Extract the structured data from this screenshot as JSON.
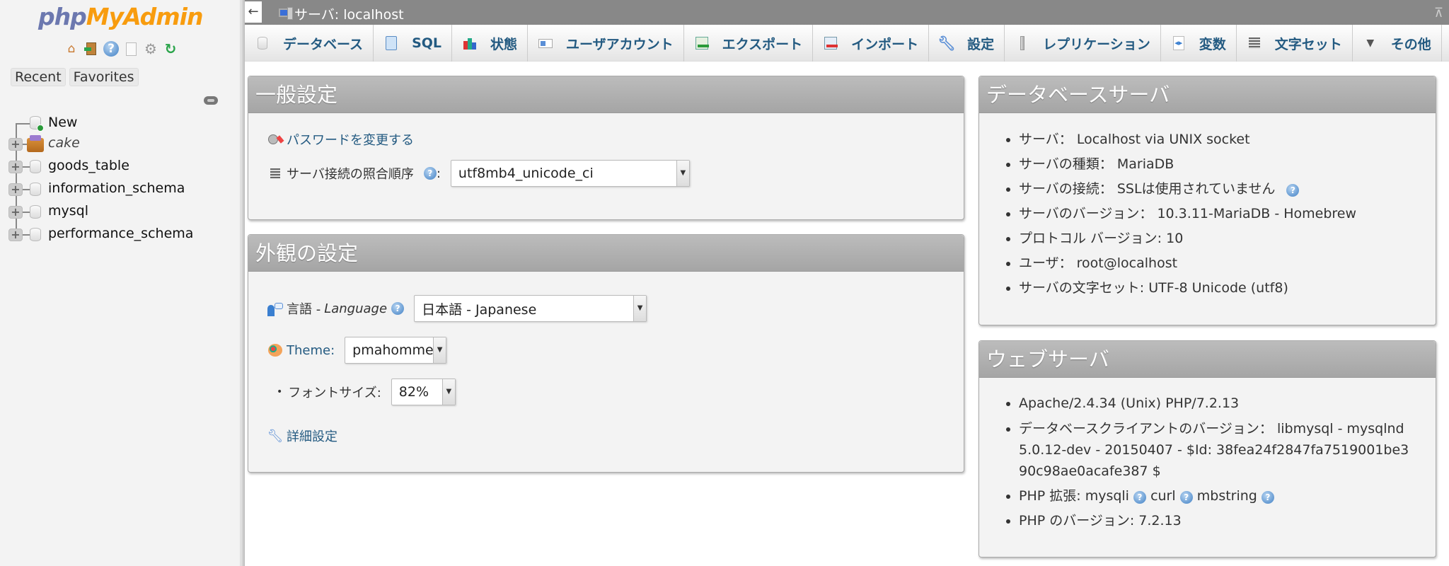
{
  "app": {
    "logo_part1": "php",
    "logo_part2": "MyAdmin"
  },
  "sidebar": {
    "nav_icons": [
      "home-icon",
      "logout-icon",
      "help-icon",
      "documentation-icon",
      "settings-icon",
      "reload-icon"
    ],
    "tabs": [
      "Recent",
      "Favorites"
    ],
    "tree": [
      {
        "label": "New",
        "type": "new",
        "icon": "database-new-icon"
      },
      {
        "label": "cake",
        "type": "db-special",
        "icon": "cake-db-icon"
      },
      {
        "label": "goods_table",
        "type": "db",
        "icon": "database-icon"
      },
      {
        "label": "information_schema",
        "type": "db",
        "icon": "database-icon"
      },
      {
        "label": "mysql",
        "type": "db",
        "icon": "database-icon"
      },
      {
        "label": "performance_schema",
        "type": "db",
        "icon": "database-icon"
      }
    ]
  },
  "topbar": {
    "back_arrow": "←",
    "server_title": "サーバ: localhost",
    "collapse_symbol": "⊼"
  },
  "tabs": [
    {
      "label": "データベース",
      "icon": "database-icon"
    },
    {
      "label": "SQL",
      "icon": "sql-scroll-icon"
    },
    {
      "label": "状態",
      "icon": "status-chart-icon"
    },
    {
      "label": "ユーザアカウント",
      "icon": "user-card-icon"
    },
    {
      "label": "エクスポート",
      "icon": "export-icon"
    },
    {
      "label": "インポート",
      "icon": "import-icon"
    },
    {
      "label": "設定",
      "icon": "wrench-icon"
    },
    {
      "label": "レプリケーション",
      "icon": "replication-icon"
    },
    {
      "label": "変数",
      "icon": "variables-icon"
    },
    {
      "label": "文字セット",
      "icon": "charset-icon"
    },
    {
      "label": "その他",
      "icon": "more-triangle-icon"
    }
  ],
  "general_settings": {
    "title": "一般設定",
    "change_password": "パスワードを変更する",
    "collation_label": "サーバ接続の照合順序",
    "collation_colon": ":",
    "collation_value": "utf8mb4_unicode_ci"
  },
  "appearance_settings": {
    "title": "外観の設定",
    "language_label_jp": "言語 - ",
    "language_label_en": "Language",
    "language_value": "日本語 - Japanese",
    "theme_label": "Theme:",
    "theme_value": "pmahomme",
    "font_size_label": "フォントサイズ:",
    "font_size_value": "82%",
    "more_settings": "詳細設定"
  },
  "database_server": {
    "title": "データベースサーバ",
    "items": [
      {
        "text": "サーバ： Localhost via UNIX socket",
        "help": false
      },
      {
        "text": "サーバの種類： MariaDB",
        "help": false
      },
      {
        "text": "サーバの接続： SSLは使用されていません",
        "help": true
      },
      {
        "text": "サーバのバージョン： 10.3.11-MariaDB - Homebrew",
        "help": false
      },
      {
        "text": "プロトコル バージョン: 10",
        "help": false
      },
      {
        "text": "ユーザ： root@localhost",
        "help": false
      },
      {
        "text": "サーバの文字セット: UTF-8 Unicode (utf8)",
        "help": false
      }
    ]
  },
  "web_server": {
    "title": "ウェブサーバ",
    "apache": "Apache/2.4.34 (Unix) PHP/7.2.13",
    "client_version": "データベースクライアントのバージョン： libmysql - mysqlnd 5.0.12-dev - 20150407 - $Id: 38fea24f2847fa7519001be390c98ae0acafe387 $",
    "php_ext_label": "PHP 拡張: ",
    "php_ext": [
      "mysqli",
      "curl",
      "mbstring"
    ],
    "php_version": "PHP のバージョン: 7.2.13"
  },
  "help_glyph": "?"
}
